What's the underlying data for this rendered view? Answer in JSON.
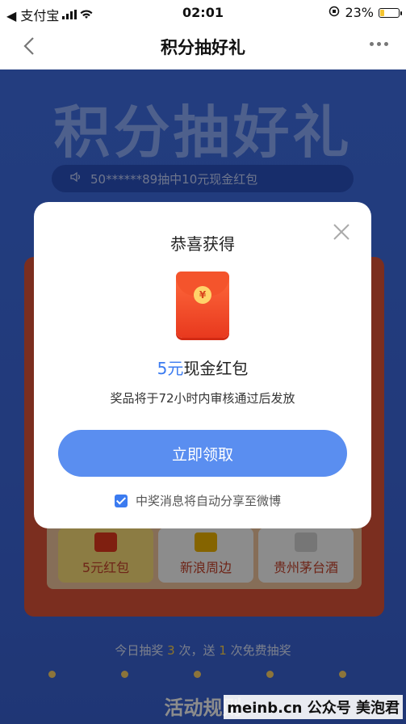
{
  "status_bar": {
    "carrier": "◀ 支付宝",
    "time": "02:01",
    "battery_percent_text": "23%",
    "battery_level": 0.23
  },
  "nav": {
    "title": "积分抽好礼"
  },
  "background": {
    "hero_title": "积分抽好礼",
    "marquee_text": "50******89抽中10元现金红包",
    "prizes": [
      "5元红包",
      "新浪周边",
      "贵州茅台酒"
    ],
    "today_prefix": "今日抽奖 ",
    "today_count": "3",
    "today_middle": " 次，送 ",
    "today_free": "1",
    "today_suffix": " 次免费抽奖",
    "rules_title": "活动规则"
  },
  "modal": {
    "title": "恭喜获得",
    "prize_amount": "5元",
    "prize_name": "现金红包",
    "note": "奖品将于72小时内审核通过后发放",
    "claim_button": "立即领取",
    "share_label": "中奖消息将自动分享至微博",
    "share_checked": true
  },
  "watermark": "meinb.cn 公众号 美泡君",
  "colors": {
    "accent": "#3b7bf0",
    "button": "#5a8ef0"
  }
}
